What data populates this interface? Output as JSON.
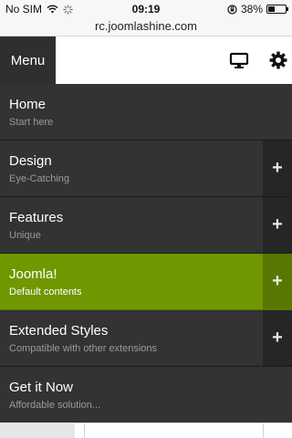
{
  "status_bar": {
    "carrier": "No SIM",
    "time": "09:19",
    "battery_percent": "38%",
    "battery_level": 0.38
  },
  "browser": {
    "url": "rc.joomlashine.com"
  },
  "toolbar": {
    "menu_label": "Menu",
    "icons": [
      "desktop-icon",
      "gear-icon"
    ]
  },
  "menu": {
    "items": [
      {
        "title": "Home",
        "subtitle": "Start here",
        "expandable": false,
        "active": false
      },
      {
        "title": "Design",
        "subtitle": "Eye-Catching",
        "expandable": true,
        "active": false
      },
      {
        "title": "Features",
        "subtitle": "Unique",
        "expandable": true,
        "active": false
      },
      {
        "title": "Joomla!",
        "subtitle": "Default contents",
        "expandable": true,
        "active": true
      },
      {
        "title": "Extended Styles",
        "subtitle": "Compatible with other extensions",
        "expandable": true,
        "active": false
      },
      {
        "title": "Get it Now",
        "subtitle": "Affordable solution...",
        "expandable": false,
        "active": false
      }
    ],
    "expand_symbol": "+"
  },
  "colors": {
    "menu_bg": "#333333",
    "active_bg": "#6f9800",
    "menu_button_bg": "#2f2f2f"
  }
}
